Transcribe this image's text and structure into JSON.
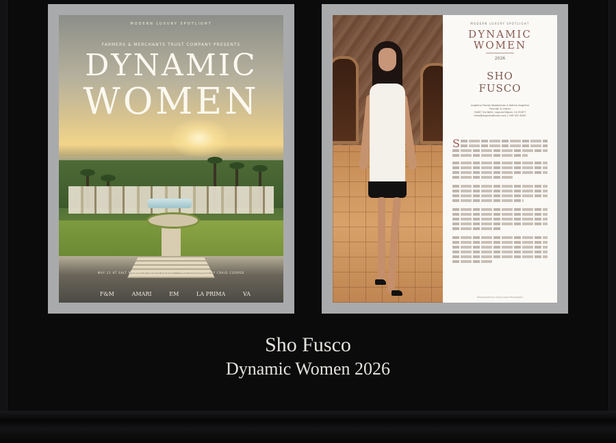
{
  "cover": {
    "eyebrow": "MODERN LUXURY SPOTLIGHT",
    "presents": "FARMERS & MERCHANTS TRUST COMPANY PRESENTS",
    "title_line1": "DYNAMIC",
    "title_line2": "WOMEN",
    "credits": "MAY 21 AT SALT MONARCH BEACH RESORT · PHOTOGRAPHED BY CRAIG COOPER",
    "logos": [
      "F&M",
      "AMARI",
      "EM",
      "LA PRIMA",
      "VA"
    ]
  },
  "spread": {
    "eyebrow": "MODERN LUXURY SPOTLIGHT",
    "title_line1": "DYNAMIC",
    "title_line2": "WOMEN",
    "year": "2026",
    "name_line1": "SHO",
    "name_line2": "FUSCO",
    "contact": [
      "Angelina Florals Headpieces & Ibérica Angelina",
      "Founder & Owner",
      "30487 Via Belle, Laguna Niguel, CA 92677",
      "hello@angelinaflorals.com | 949.937.8200"
    ],
    "dropcap": "S",
    "footnote": "Photographed by Craig Cooper Photography"
  },
  "caption": {
    "name": "Sho Fusco",
    "title": "Dynamic Women 2026"
  }
}
